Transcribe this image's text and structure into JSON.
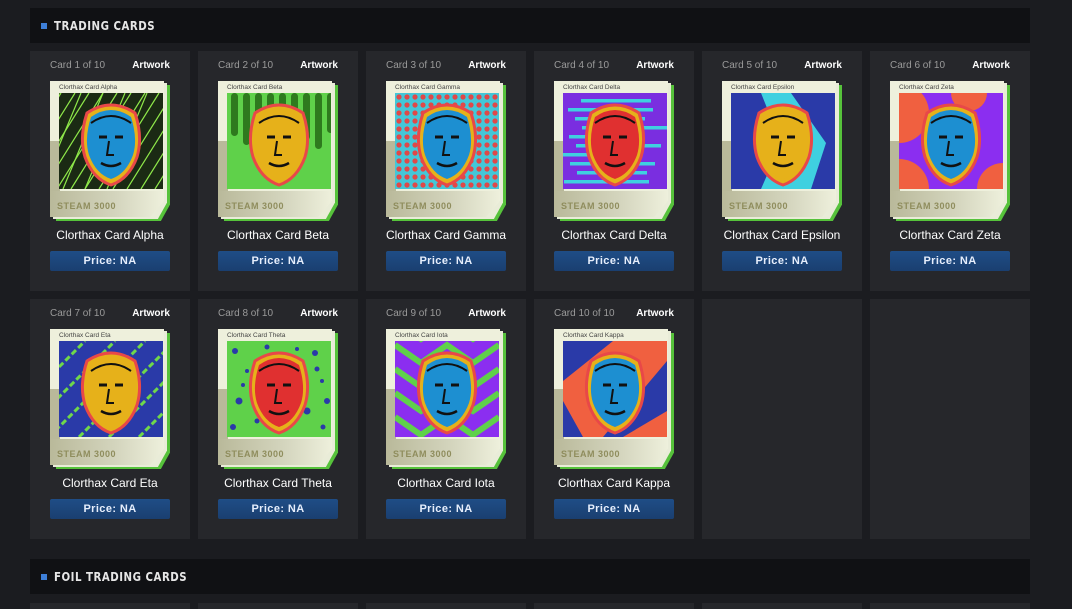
{
  "sections": {
    "trading_title": "TRADING CARDS",
    "foil_title": "FOIL TRADING CARDS"
  },
  "artwork_label": "Artwork",
  "brand": "STEAM 3000",
  "cards": [
    {
      "num": "Card 1 of 10",
      "name": "Clorthax Card Alpha",
      "mini": "Clorthax Card Alpha",
      "price": "Price: NA",
      "bg": "#1b2a14",
      "fg": "#8fe94a",
      "face": "#1d8fd1",
      "pattern": "lines"
    },
    {
      "num": "Card 2 of 10",
      "name": "Clorthax Card Beta",
      "mini": "Clorthax Card Beta",
      "price": "Price: NA",
      "bg": "#5fd14a",
      "fg": "#2e7a1e",
      "face": "#e6b11a",
      "pattern": "pipes"
    },
    {
      "num": "Card 3 of 10",
      "name": "Clorthax Card Gamma",
      "mini": "Clorthax Card Gamma",
      "price": "Price: NA",
      "bg": "#43c7d8",
      "fg": "#e04848",
      "face": "#1d8fd1",
      "pattern": "dots"
    },
    {
      "num": "Card 4 of 10",
      "name": "Clorthax Card Delta",
      "mini": "Clorthax Card Delta",
      "price": "Price: NA",
      "bg": "#7a2ee0",
      "fg": "#3fd0e0",
      "face": "#e03030",
      "pattern": "hstripes"
    },
    {
      "num": "Card 5 of 10",
      "name": "Clorthax Card Epsilon",
      "mini": "Clorthax Card Epsilon",
      "price": "Price: NA",
      "bg": "#3fd0e0",
      "fg": "#2a3aa8",
      "face": "#e6b11a",
      "pattern": "zigzag"
    },
    {
      "num": "Card 6 of 10",
      "name": "Clorthax Card Zeta",
      "mini": "Clorthax Card Zeta",
      "price": "Price: NA",
      "bg": "#8b2ef0",
      "fg": "#f06040",
      "face": "#1d8fd1",
      "pattern": "arcs"
    },
    {
      "num": "Card 7 of 10",
      "name": "Clorthax Card Eta",
      "mini": "Clorthax Card Eta",
      "price": "Price: NA",
      "bg": "#2a3aa8",
      "fg": "#6fd84a",
      "face": "#e6b11a",
      "pattern": "diag"
    },
    {
      "num": "Card 8 of 10",
      "name": "Clorthax Card Theta",
      "mini": "Clorthax Card Theta",
      "price": "Price: NA",
      "bg": "#5fd14a",
      "fg": "#2a3aa8",
      "face": "#e03030",
      "pattern": "spots"
    },
    {
      "num": "Card 9 of 10",
      "name": "Clorthax Card Iota",
      "mini": "Clorthax Card Iota",
      "price": "Price: NA",
      "bg": "#8b2ef0",
      "fg": "#5fd14a",
      "face": "#1d8fd1",
      "pattern": "chevron"
    },
    {
      "num": "Card 10 of 10",
      "name": "Clorthax Card Kappa",
      "mini": "Clorthax Card Kappa",
      "price": "Price: NA",
      "bg": "#f06040",
      "fg": "#2a3aa8",
      "face": "#1d8fd1",
      "pattern": "shards"
    }
  ]
}
